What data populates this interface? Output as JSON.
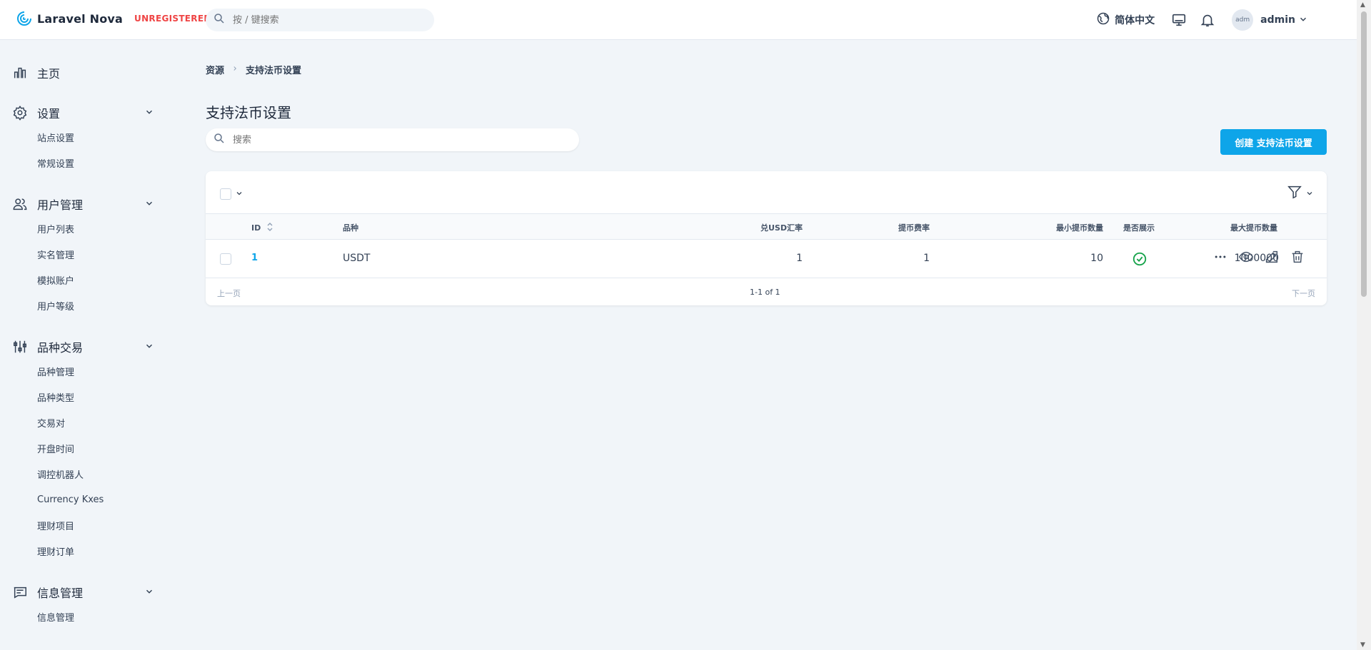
{
  "header": {
    "brand_name": "Laravel Nova",
    "brand_tag": "UNREGISTERED",
    "search_placeholder": "按 / 键搜索",
    "language": "简体中文",
    "avatar_alt": "adm",
    "user_name": "admin"
  },
  "sidebar": {
    "sections": [
      {
        "label": "主页",
        "icon": "chart-bar-icon",
        "items": []
      },
      {
        "label": "设置",
        "icon": "gear-icon",
        "items": [
          "站点设置",
          "常规设置"
        ]
      },
      {
        "label": "用户管理",
        "icon": "users-icon",
        "items": [
          "用户列表",
          "实名管理",
          "模拟账户",
          "用户等级"
        ]
      },
      {
        "label": "品种交易",
        "icon": "sliders-icon",
        "items": [
          "品种管理",
          "品种类型",
          "交易对",
          "开盘时间",
          "调控机器人",
          "Currency Kxes",
          "理财项目",
          "理财订单"
        ]
      },
      {
        "label": "信息管理",
        "icon": "chat-icon",
        "items": [
          "信息管理"
        ]
      }
    ]
  },
  "breadcrumb": {
    "root": "资源",
    "current": "支持法币设置"
  },
  "page": {
    "title": "支持法币设置",
    "search_placeholder": "搜索",
    "create_label": "创建 支持法币设置"
  },
  "table": {
    "columns": [
      "ID",
      "品种",
      "兑USD汇率",
      "提币费率",
      "最小提币数量",
      "最大提币数量",
      "是否展示"
    ],
    "rows": [
      {
        "id": "1",
        "symbol": "USDT",
        "rate": "1",
        "fee": "1",
        "min": "10",
        "max": "1000000",
        "visible": true
      }
    ]
  },
  "pagination": {
    "prev": "上一页",
    "info": "1-1 of 1",
    "next": "下一页"
  },
  "colors": {
    "accent": "#0ea5e9",
    "success": "#16a34a",
    "danger": "#ef4444"
  }
}
